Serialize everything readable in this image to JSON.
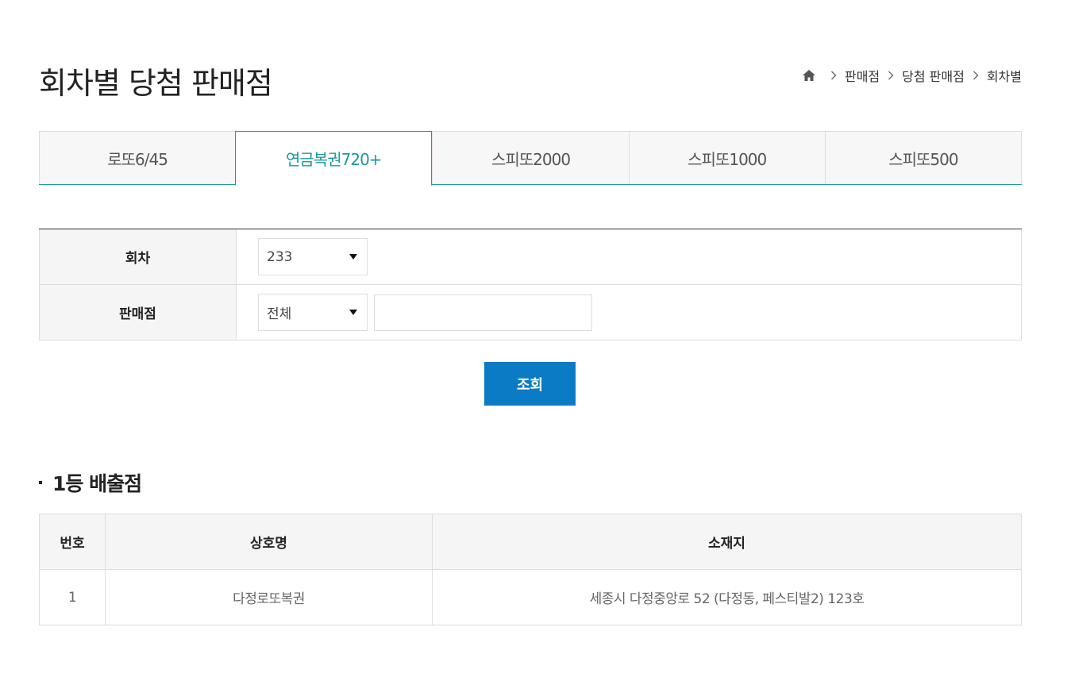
{
  "header": {
    "title": "회차별 당첨 판매점",
    "breadcrumb": [
      "판매점",
      "당첨 판매점",
      "회차별"
    ]
  },
  "tabs": [
    {
      "label": "로또6/45",
      "active": false
    },
    {
      "label": "연금복권720+",
      "active": true
    },
    {
      "label": "스피또2000",
      "active": false
    },
    {
      "label": "스피또1000",
      "active": false
    },
    {
      "label": "스피또500",
      "active": false
    }
  ],
  "form": {
    "round_label": "회차",
    "round_value": "233",
    "store_label": "판매점",
    "store_filter_value": "전체",
    "store_search_value": ""
  },
  "search_button": "조회",
  "section": {
    "title": "1등 배출점"
  },
  "results": {
    "headers": [
      "번호",
      "상호명",
      "소재지"
    ],
    "rows": [
      [
        "1",
        "다정로또복권",
        "세종시 다정중앙로 52 (다정동, 페스티발2) 123호"
      ]
    ]
  },
  "colors": {
    "accent": "#1a9aa0",
    "button": "#0c7bc5"
  }
}
